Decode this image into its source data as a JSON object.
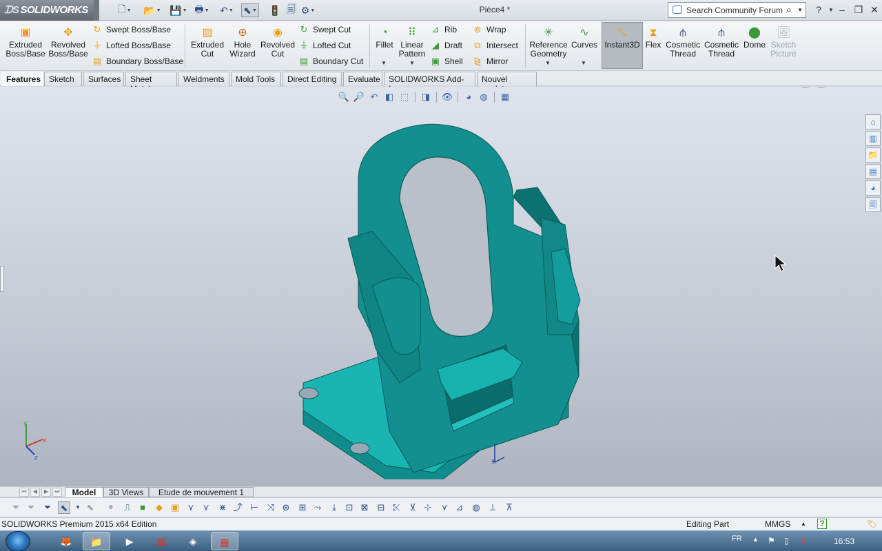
{
  "app": {
    "logo_text": "SOLIDWORKS",
    "document_title": "Pièce4 *",
    "search_placeholder": "Search Community Forum"
  },
  "toolbar": {
    "features": {
      "extruded_boss": "Extruded\nBoss/Base",
      "revolved_boss": "Revolved\nBoss/Base",
      "swept_boss": "Swept Boss/Base",
      "lofted_boss": "Lofted Boss/Base",
      "boundary_boss": "Boundary Boss/Base",
      "extruded_cut": "Extruded\nCut",
      "hole_wizard": "Hole\nWizard",
      "revolved_cut": "Revolved\nCut",
      "swept_cut": "Swept Cut",
      "lofted_cut": "Lofted Cut",
      "boundary_cut": "Boundary Cut",
      "fillet": "Fillet",
      "linear_pattern": "Linear\nPattern",
      "rib": "Rib",
      "draft": "Draft",
      "shell": "Shell",
      "wrap": "Wrap",
      "intersect": "Intersect",
      "mirror": "Mirror",
      "reference_geometry": "Reference\nGeometry",
      "curves": "Curves",
      "instant3d": "Instant3D",
      "flex": "Flex",
      "cosmetic_thread_1": "Cosmetic\nThread",
      "cosmetic_thread_2": "Cosmetic\nThread",
      "dome": "Dome",
      "sketch_picture": "Sketch\nPicture"
    }
  },
  "tabs": [
    "Features",
    "Sketch",
    "Surfaces",
    "Sheet Metal",
    "Weldments",
    "Mold Tools",
    "Direct Editing",
    "Evaluate",
    "SOLIDWORKS Add-Ins",
    "Nouvel onglet"
  ],
  "active_tab": "Features",
  "bottom_tabs": [
    "Model",
    "3D Views",
    "Etude de mouvement 1"
  ],
  "active_bottom_tab": "Model",
  "status": {
    "product": "SOLIDWORKS Premium 2015 x64 Edition",
    "mode": "Editing Part",
    "units": "MMGS",
    "help_icon": "?"
  },
  "triad": {
    "x": "x",
    "y": "y",
    "z": "z"
  },
  "taskbar": {
    "language": "FR",
    "time": "16:53"
  },
  "colors": {
    "model": "#1aa9a8",
    "model_dark": "#118a89",
    "accent": "#3a73c4"
  }
}
